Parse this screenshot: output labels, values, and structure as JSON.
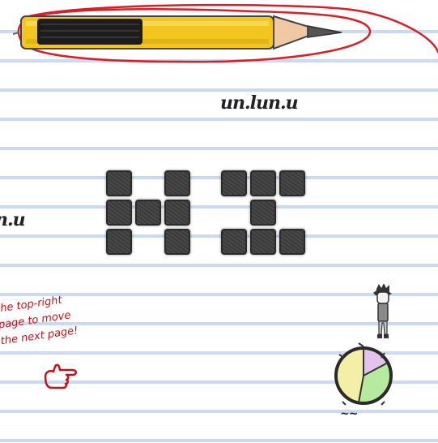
{
  "game": {
    "hint_lines": "the top-right\npage to move\nthe next page!",
    "scribble_top": "un.lun.u",
    "scribble_left": "n.u",
    "scribble_bottom": "~~",
    "grid_text": "HI",
    "colors": {
      "highlight": "#d81f26",
      "pencil_body": "#f3c51f",
      "pencil_tip": "#f1c8a4",
      "blocks": "#3a3a3a",
      "hint": "#c4121a",
      "clock_purple": "#e3c3ec",
      "clock_green": "#b6ea9e",
      "clock_yellow": "#f4efa6"
    },
    "icons": [
      "pencil-icon",
      "pointing-hand-icon",
      "clock-timer-icon",
      "character-sprite"
    ]
  }
}
